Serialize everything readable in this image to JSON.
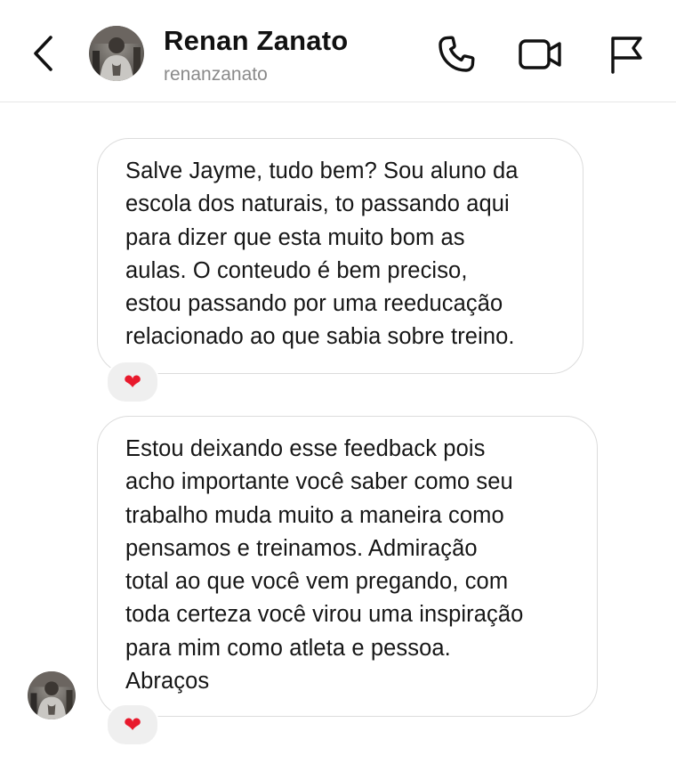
{
  "header": {
    "name": "Renan Zanato",
    "username": "renanzanato",
    "icons": {
      "back": "chevron-left-icon",
      "call": "phone-icon",
      "video": "video-camera-icon",
      "report": "flag-icon"
    }
  },
  "messages": [
    {
      "text": "Salve Jayme, tudo bem? Sou aluno da\nescola dos naturais, to passando aqui\npara dizer que esta muito bom as\naulas. O conteudo é bem preciso,\nestou passando por uma reeducação\nrelacionado ao que sabia sobre treino.",
      "reaction": "❤"
    },
    {
      "text": "Estou deixando esse feedback pois\nacho importante você saber como seu\ntrabalho muda muito a maneira como\npensamos e treinamos. Admiração\ntotal ao que você vem pregando, com\ntoda certeza você virou uma inspiração\npara mim como atleta e pessoa.\nAbraços",
      "reaction": "❤"
    }
  ],
  "colors": {
    "heart": "#e8192c",
    "bubble_border": "#dcdcdc",
    "reaction_bg": "#efefef",
    "username": "#8a8a8a"
  }
}
